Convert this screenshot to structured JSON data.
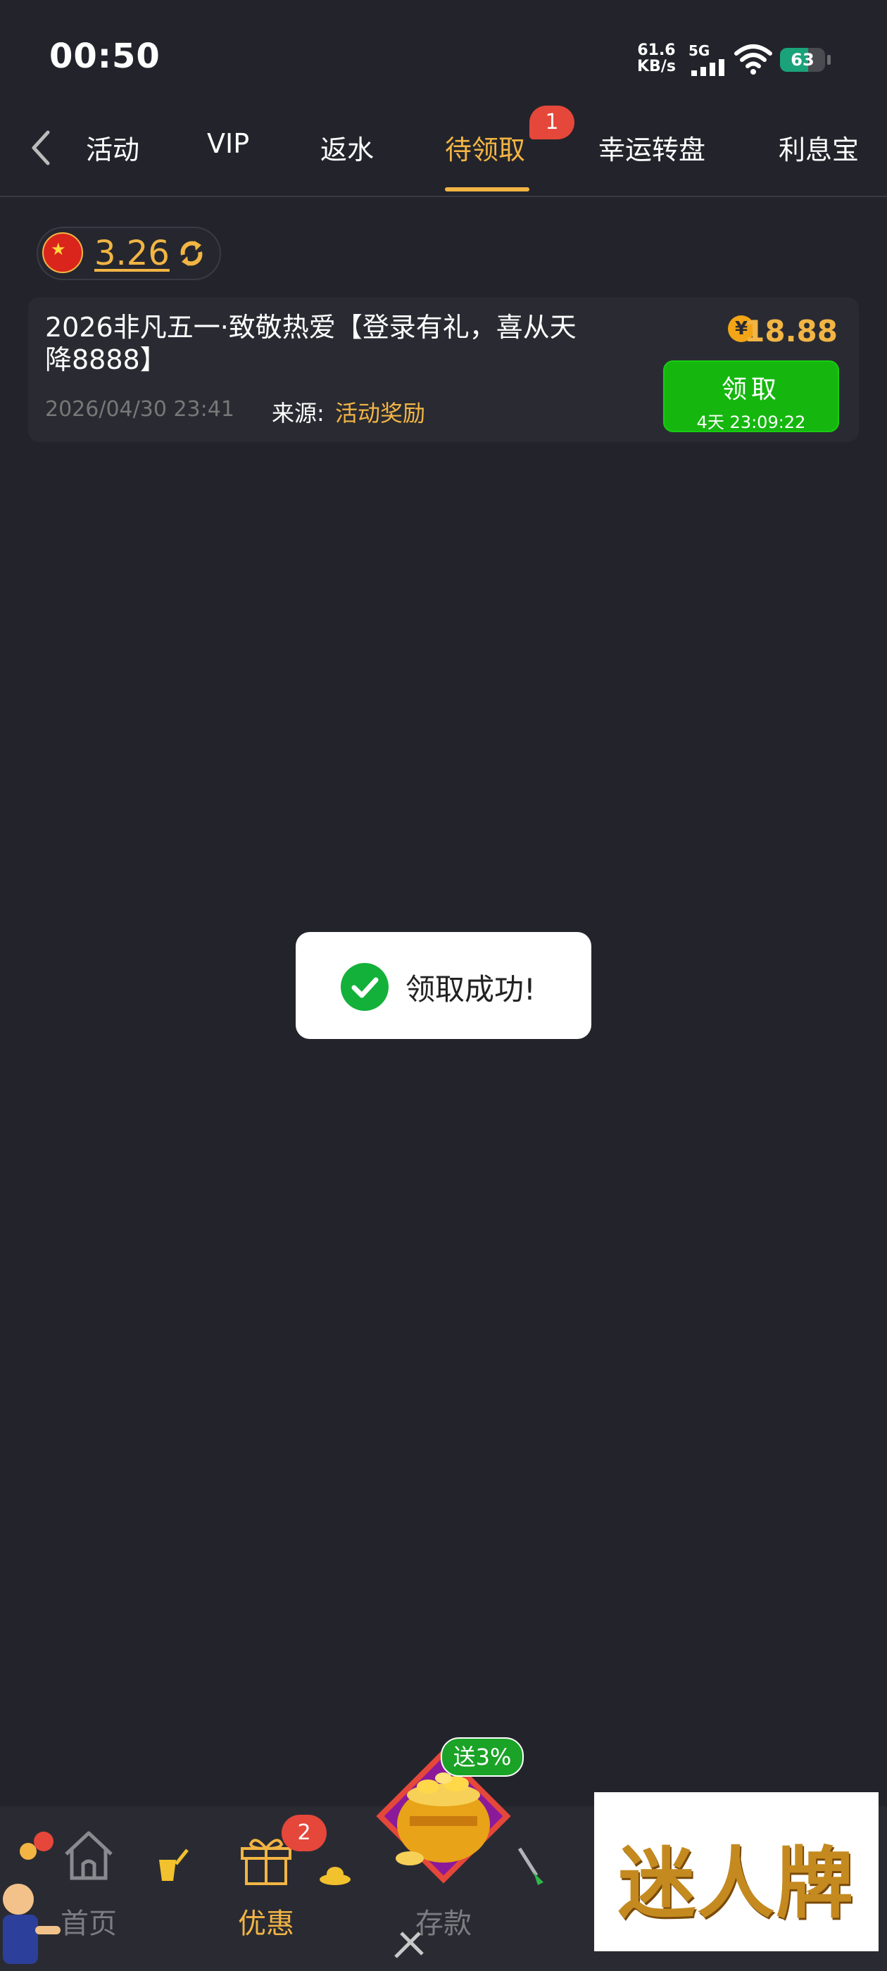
{
  "status_bar": {
    "time": "00:50",
    "net_speed_value": "61.6",
    "net_speed_unit": "KB/s",
    "network_type": "5G",
    "battery_level": "63",
    "battery_color": "#1aa37a"
  },
  "tabs": {
    "items": [
      {
        "label": "活动"
      },
      {
        "label": "VIP"
      },
      {
        "label": "返水"
      },
      {
        "label": "待领取",
        "active": true
      },
      {
        "label": "幸运转盘"
      },
      {
        "label": "利息宝"
      }
    ],
    "pending_badge": "1",
    "active_color": "#f2b544"
  },
  "balance": {
    "amount": "3.26"
  },
  "reward_card": {
    "title": "2026非凡五一·致敬热爱【登录有礼，喜从天降8888】",
    "date": "2026/04/30 23:41",
    "source_label": "来源:",
    "source_value": "活动奖励",
    "coin_symbol": "¥",
    "amount": "18.88",
    "claim_button": "领取",
    "countdown": "4天 23:09:22"
  },
  "toast": {
    "message": "领取成功!"
  },
  "bottom_nav": {
    "items": [
      {
        "label": "首页",
        "icon": "home-icon"
      },
      {
        "label": "优惠",
        "icon": "gift-icon",
        "active": true
      },
      {
        "label": "存款",
        "icon": "treasure-pot-icon"
      }
    ],
    "promo_badge": "2",
    "deposit_tag": "送3%"
  },
  "ad_watermark": {
    "text": "迷人牌"
  }
}
